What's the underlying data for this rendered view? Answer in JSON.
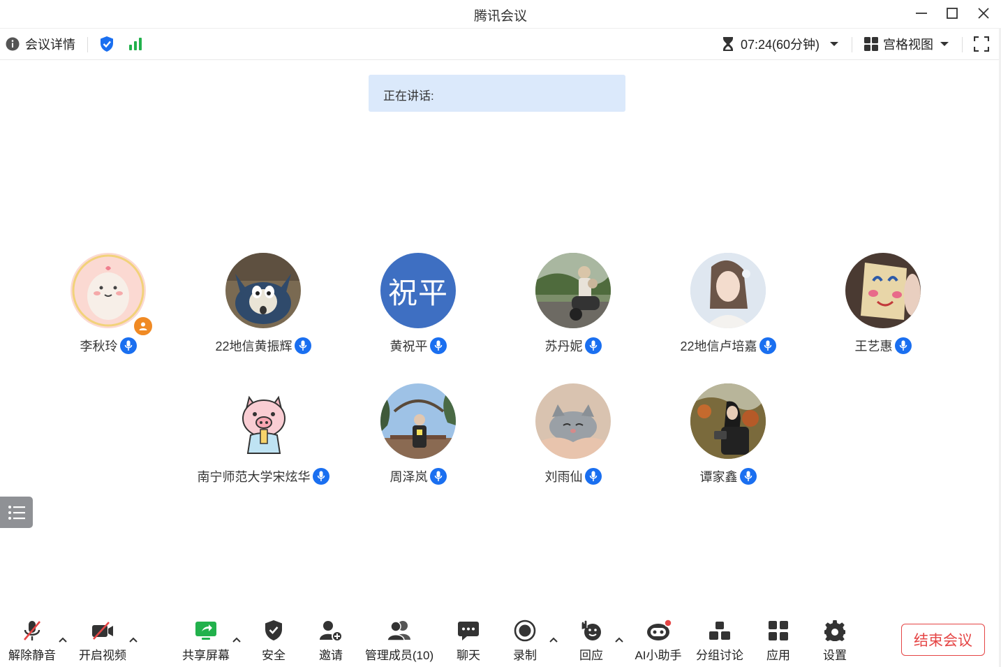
{
  "window": {
    "title": "腾讯会议"
  },
  "topbar": {
    "meeting_info": "会议详情",
    "timer": "07:24(60分钟)",
    "view_mode": "宫格视图"
  },
  "speaking": {
    "label": "正在讲话:"
  },
  "participants": [
    {
      "name": "李秋玲",
      "avatar_text": "",
      "is_host": true
    },
    {
      "name": "22地信黄振辉",
      "avatar_text": ""
    },
    {
      "name": "黄祝平",
      "avatar_text": "祝平"
    },
    {
      "name": "苏丹妮",
      "avatar_text": ""
    },
    {
      "name": "22地信卢培嘉",
      "avatar_text": ""
    },
    {
      "name": "王艺惠",
      "avatar_text": ""
    },
    {
      "name": "南宁师范大学宋炫华",
      "avatar_text": ""
    },
    {
      "name": "周泽岚",
      "avatar_text": ""
    },
    {
      "name": "刘雨仙",
      "avatar_text": ""
    },
    {
      "name": "谭家鑫",
      "avatar_text": ""
    }
  ],
  "bottombar": {
    "unmute": "解除静音",
    "start_video": "开启视频",
    "share_screen": "共享屏幕",
    "security": "安全",
    "invite": "邀请",
    "manage_members": "管理成员(10)",
    "chat": "聊天",
    "record": "录制",
    "reactions": "回应",
    "ai_assistant": "AI小助手",
    "breakout": "分组讨论",
    "apps": "应用",
    "settings": "设置",
    "end_meeting": "结束会议"
  },
  "colors": {
    "accent_blue": "#1a6ff0",
    "end_red": "#e54545",
    "signal_green": "#22b14c",
    "speaking_bg": "#dbe9fb",
    "avatar_blue": "#3e6fc2"
  }
}
